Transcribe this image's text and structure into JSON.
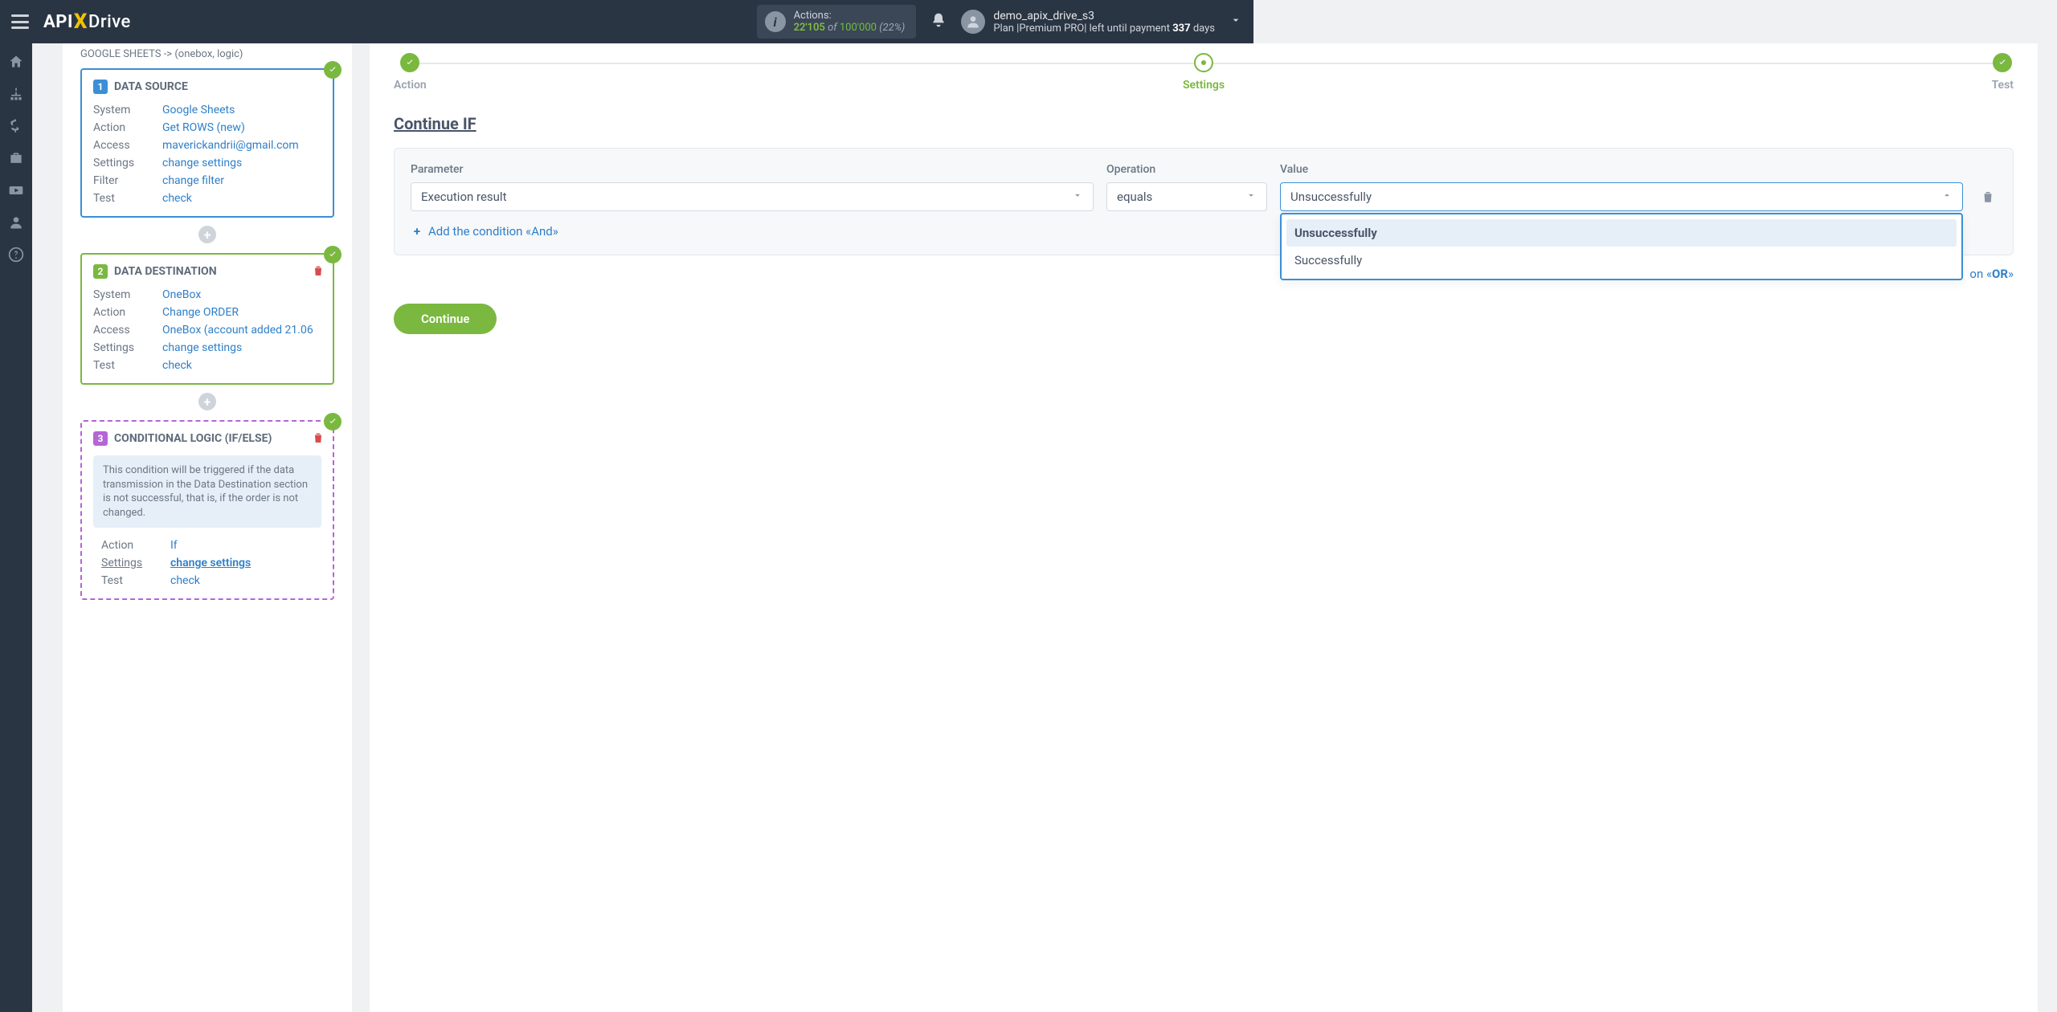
{
  "header": {
    "actions_label": "Actions:",
    "actions_current": "22'105",
    "actions_of": " of ",
    "actions_max": "100'000",
    "actions_pct": " (22%)",
    "user_name": "demo_apix_drive_s3",
    "plan_prefix": "Plan |Premium PRO| left until payment ",
    "plan_days": "337",
    "plan_suffix": " days"
  },
  "breadcrumb": "GOOGLE SHEETS -> (onebox, logic)",
  "cards": {
    "source": {
      "num": "1",
      "title": "DATA SOURCE",
      "system_k": "System",
      "system_v": "Google Sheets",
      "action_k": "Action",
      "action_v": "Get ROWS (new)",
      "access_k": "Access",
      "access_v": "maverickandrii@gmail.com",
      "settings_k": "Settings",
      "settings_v": "change settings",
      "filter_k": "Filter",
      "filter_v": "change filter",
      "test_k": "Test",
      "test_v": "check"
    },
    "dest": {
      "num": "2",
      "title": "DATA DESTINATION",
      "system_k": "System",
      "system_v": "OneBox",
      "action_k": "Action",
      "action_v": "Change ORDER",
      "access_k": "Access",
      "access_v": "OneBox (account added 21.06",
      "settings_k": "Settings",
      "settings_v": "change settings",
      "test_k": "Test",
      "test_v": "check"
    },
    "logic": {
      "num": "3",
      "title": "CONDITIONAL LOGIC (IF/ELSE)",
      "msg": "This condition will be triggered if the data transmission in the Data Destination section is not successful, that is, if the order is not changed.",
      "action_k": "Action",
      "action_v": "If",
      "settings_k": "Settings",
      "settings_v": "change settings",
      "test_k": "Test",
      "test_v": "check"
    }
  },
  "steps": {
    "s1": "Action",
    "s2": "Settings",
    "s3": "Test"
  },
  "section_title": "Continue IF",
  "cond": {
    "param_label": "Parameter",
    "param_value": "Execution result",
    "op_label": "Operation",
    "op_value": "equals",
    "val_label": "Value",
    "val_value": "Unsuccessfully",
    "opt1": "Unsuccessfully",
    "opt2": "Successfully",
    "add_and": "Add the condition «And»",
    "or_prefix": "on «",
    "or_bold": "OR",
    "or_suffix": "»"
  },
  "continue_btn": "Continue"
}
